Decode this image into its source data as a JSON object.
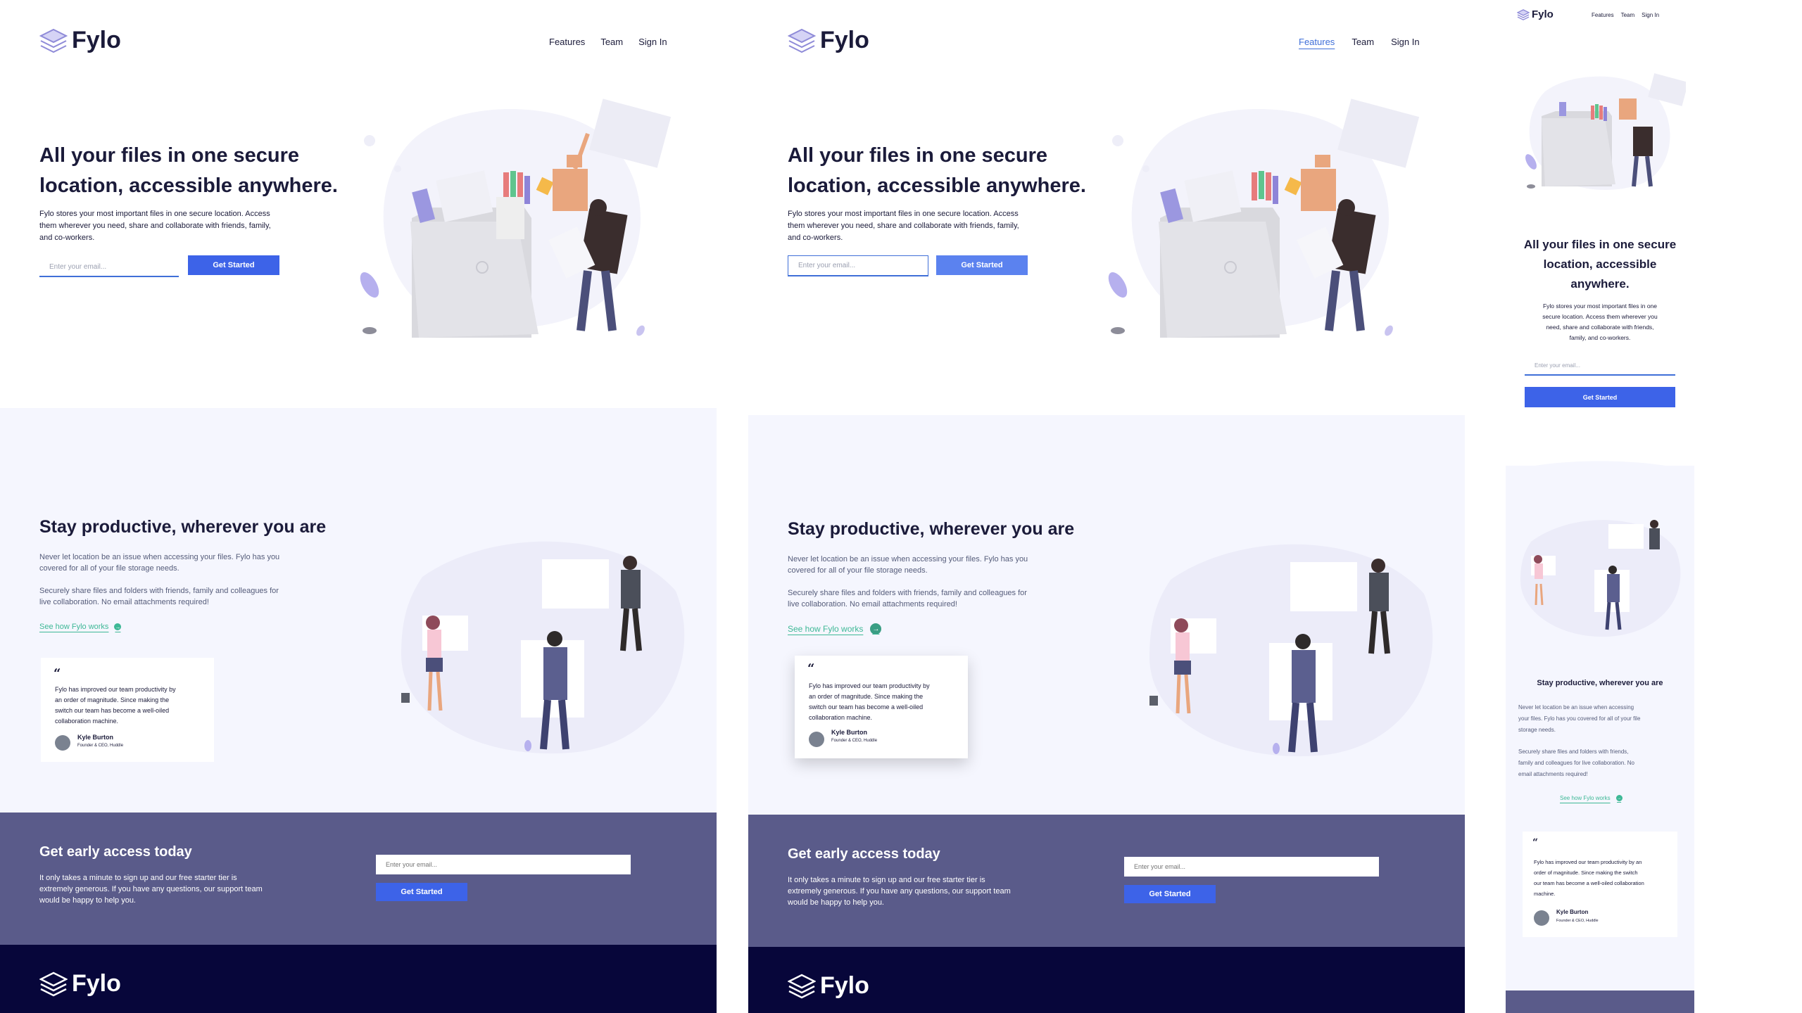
{
  "brand": {
    "name": "Fylo"
  },
  "nav": {
    "features": "Features",
    "team": "Team",
    "signin": "Sign In"
  },
  "hero": {
    "title_line1": "All your files in one secure",
    "title_line2": "location, accessible anywhere.",
    "mobile_title_1": "All your files in one secure",
    "mobile_title_2": "location, accessible",
    "mobile_title_3": "anywhere.",
    "desc_1": "Fylo stores your most important files in one secure location. Access",
    "desc_2": "them wherever you need, share and collaborate with friends, family,",
    "desc_3": "and co-workers.",
    "mdesc_1": "Fylo stores your most important files in one",
    "mdesc_2": "secure location. Access them wherever you",
    "mdesc_3": "need, share and collaborate with friends,",
    "mdesc_4": "family, and co-workers.",
    "email_placeholder": "Enter your email...",
    "cta": "Get Started"
  },
  "productive": {
    "title": "Stay productive, wherever you are",
    "p1_1": "Never let location be an issue when accessing your files. Fylo has you",
    "p1_2": "covered for all of your file storage needs.",
    "p2_1": "Securely share files and folders with friends, family and colleagues for",
    "p2_2": "live collaboration. No email attachments required!",
    "mp1_1": "Never let location be an issue when accessing",
    "mp1_2": "your files. Fylo has you covered for all of your file",
    "mp1_3": "storage needs.",
    "mp2_1": "Securely share files and folders with friends,",
    "mp2_2": "family and colleagues for live collaboration. No",
    "mp2_3": "email attachments required!",
    "link": "See how Fylo works",
    "arrow": "→"
  },
  "testimonial": {
    "mark": "“",
    "t1": "Fylo has improved our team productivity by",
    "t2": "an order of magnitude. Since making the",
    "t3": "switch our team has become a well-oiled",
    "t4": "collaboration machine.",
    "mt1": "Fylo has improved our team productivity by an",
    "mt2": "order of magnitude. Since making the switch",
    "mt3": "our team has become a well-oiled collaboration",
    "mt4": "machine.",
    "name": "Kyle Burton",
    "role": "Founder & CEO, Huddle"
  },
  "early": {
    "title": "Get early access today",
    "d1": "It only takes a minute to sign up and our free starter tier is",
    "d2": "extremely generous. If you have any questions, our support team",
    "d3": "would be happy to help you.",
    "placeholder": "Enter your email...",
    "cta": "Get Started"
  },
  "colors": {
    "primary": "#3d63e8",
    "teal": "#3eb896",
    "cta_bg": "#5a5b8a",
    "footer_bg": "#07063a",
    "section_bg": "#f5f6fe"
  }
}
